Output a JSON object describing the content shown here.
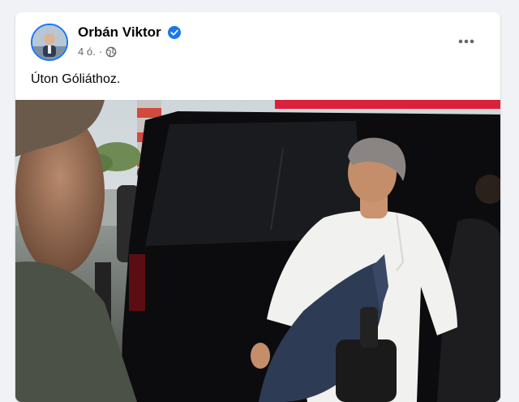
{
  "post": {
    "author": "Orbán Viktor",
    "timestamp": "4 ó.",
    "separator": "·",
    "text": "Úton Góliáthoz.",
    "more_label": "•••"
  },
  "icons": {
    "verified": "verified-badge-icon",
    "audience": "globe-icon",
    "more": "more-options-icon"
  },
  "colors": {
    "accent": "#1877f2",
    "page_background": "#f0f2f5",
    "card_background": "#ffffff",
    "secondary_text": "#65676b"
  }
}
